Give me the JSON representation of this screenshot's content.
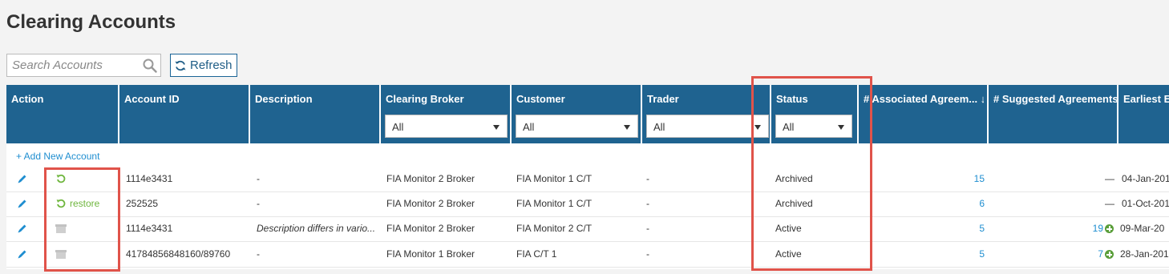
{
  "page_title": "Clearing Accounts",
  "search": {
    "placeholder": "Search Accounts",
    "value": ""
  },
  "refresh_label": "Refresh",
  "columns": [
    {
      "label": "Action"
    },
    {
      "label": "Account ID"
    },
    {
      "label": "Description"
    },
    {
      "label": "Clearing Broker",
      "filter": "All"
    },
    {
      "label": "Customer",
      "filter": "All"
    },
    {
      "label": "Trader",
      "filter": "All"
    },
    {
      "label": "Status",
      "filter": "All"
    },
    {
      "label": "# Associated Agreem... ↓"
    },
    {
      "label": "# Suggested Agreements"
    },
    {
      "label": "Earliest Ef"
    }
  ],
  "add_new_label": "+ Add New Account",
  "restore_label": "restore",
  "rows": [
    {
      "action": "restore-icon",
      "account_id": "1114e3431",
      "description": "-",
      "broker": "FIA Monitor 2 Broker",
      "customer": "FIA Monitor 1 C/T",
      "trader": "-",
      "status": "Archived",
      "associated": "15",
      "suggested": "—",
      "earliest": "04-Jan-201"
    },
    {
      "action": "restore",
      "account_id": "252525",
      "description": "-",
      "broker": "FIA Monitor 2 Broker",
      "customer": "FIA Monitor 1 C/T",
      "trader": "-",
      "status": "Archived",
      "associated": "6",
      "suggested": "—",
      "earliest": "01-Oct-201"
    },
    {
      "action": "archive-icon",
      "account_id": "1114e3431",
      "description": "Description differs in vario...",
      "broker": "FIA Monitor 2 Broker",
      "customer": "FIA Monitor 2 C/T",
      "trader": "-",
      "status": "Active",
      "associated": "5",
      "suggested": "19",
      "earliest": "09-Mar-20"
    },
    {
      "action": "archive-icon",
      "account_id": "41784856848160/89760",
      "description": "-",
      "broker": "FIA Monitor 1 Broker",
      "customer": "FIA C/T 1",
      "trader": "-",
      "status": "Active",
      "associated": "5",
      "suggested": "7",
      "earliest": "28-Jan-201"
    }
  ],
  "colors": {
    "header_bg": "#1f6390",
    "link": "#1f8ed0",
    "restore_green": "#6fb63e",
    "highlight": "#e0534a"
  }
}
